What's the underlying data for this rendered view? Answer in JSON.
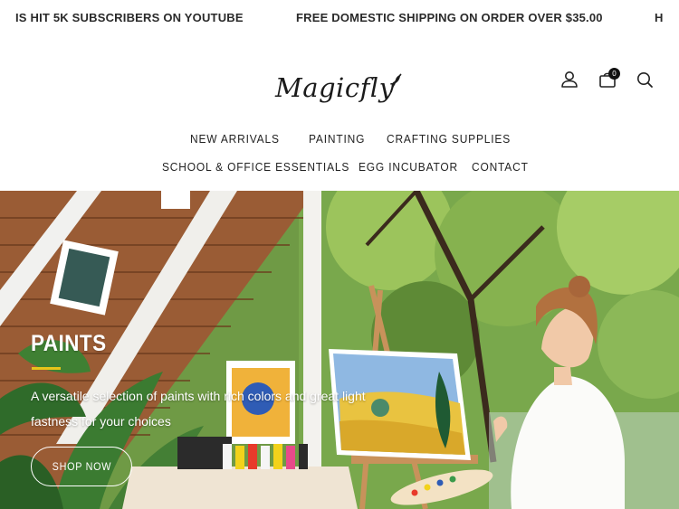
{
  "announcement": {
    "items": [
      "IS HIT 5K SUBSCRIBERS ON YOUTUBE",
      "FREE DOMESTIC SHIPPING ON ORDER OVER $35.00",
      "H"
    ]
  },
  "brand": {
    "logo_text": "Magicfly"
  },
  "header": {
    "cart_count": "0"
  },
  "nav": {
    "items": [
      "NEW ARRIVALS",
      "PAINTING",
      "CRAFTING SUPPLIES",
      "SCHOOL & OFFICE ESSENTIALS",
      "EGG INCUBATOR",
      "CONTACT"
    ]
  },
  "hero": {
    "title": "PAINTS",
    "description": "A versatile selection of paints with rich colors and great light fastness for your choices",
    "button_label": "SHOP NOW",
    "accent_color": "#e7c41a"
  },
  "icons": [
    "account-icon",
    "cart-icon",
    "search-icon",
    "leaf-icon"
  ]
}
